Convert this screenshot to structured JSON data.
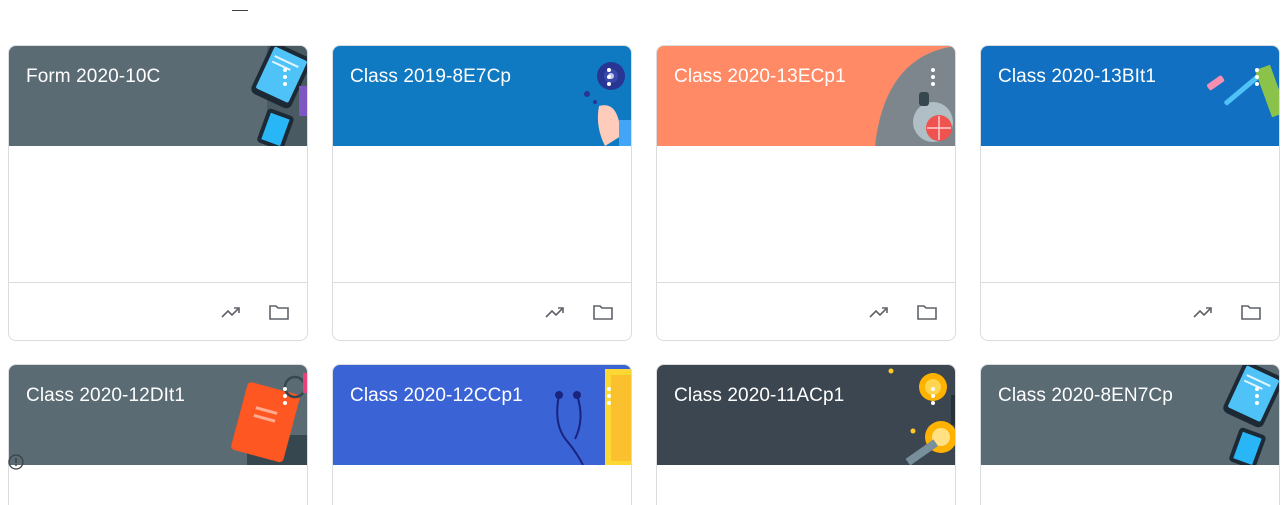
{
  "classes_row1": [
    {
      "name": "Form 2020-10C",
      "color": "#5a6b74",
      "theme": "tablet"
    },
    {
      "name": "Class 2019-8E7Cp",
      "color": "#0f79c2",
      "theme": "camera"
    },
    {
      "name": "Class 2020-13ECp1",
      "color": "#ff8a65",
      "theme": "pot"
    },
    {
      "name": "Class 2020-13BIt1",
      "color": "#1170c1",
      "theme": "pens"
    }
  ],
  "classes_row2": [
    {
      "name": "Class 2020-12DIt1",
      "color": "#5a6b74",
      "theme": "book"
    },
    {
      "name": "Class 2020-12CCp1",
      "color": "#3a63d6",
      "theme": "headphones"
    },
    {
      "name": "Class 2020-11ACp1",
      "color": "#3c4650",
      "theme": "planets"
    },
    {
      "name": "Class 2020-8EN7Cp",
      "color": "#5a6b74",
      "theme": "tablet"
    }
  ],
  "icons": {
    "more": "more-vert-icon",
    "trend": "trending-up-icon",
    "folder": "folder-icon",
    "info": "info-icon"
  }
}
